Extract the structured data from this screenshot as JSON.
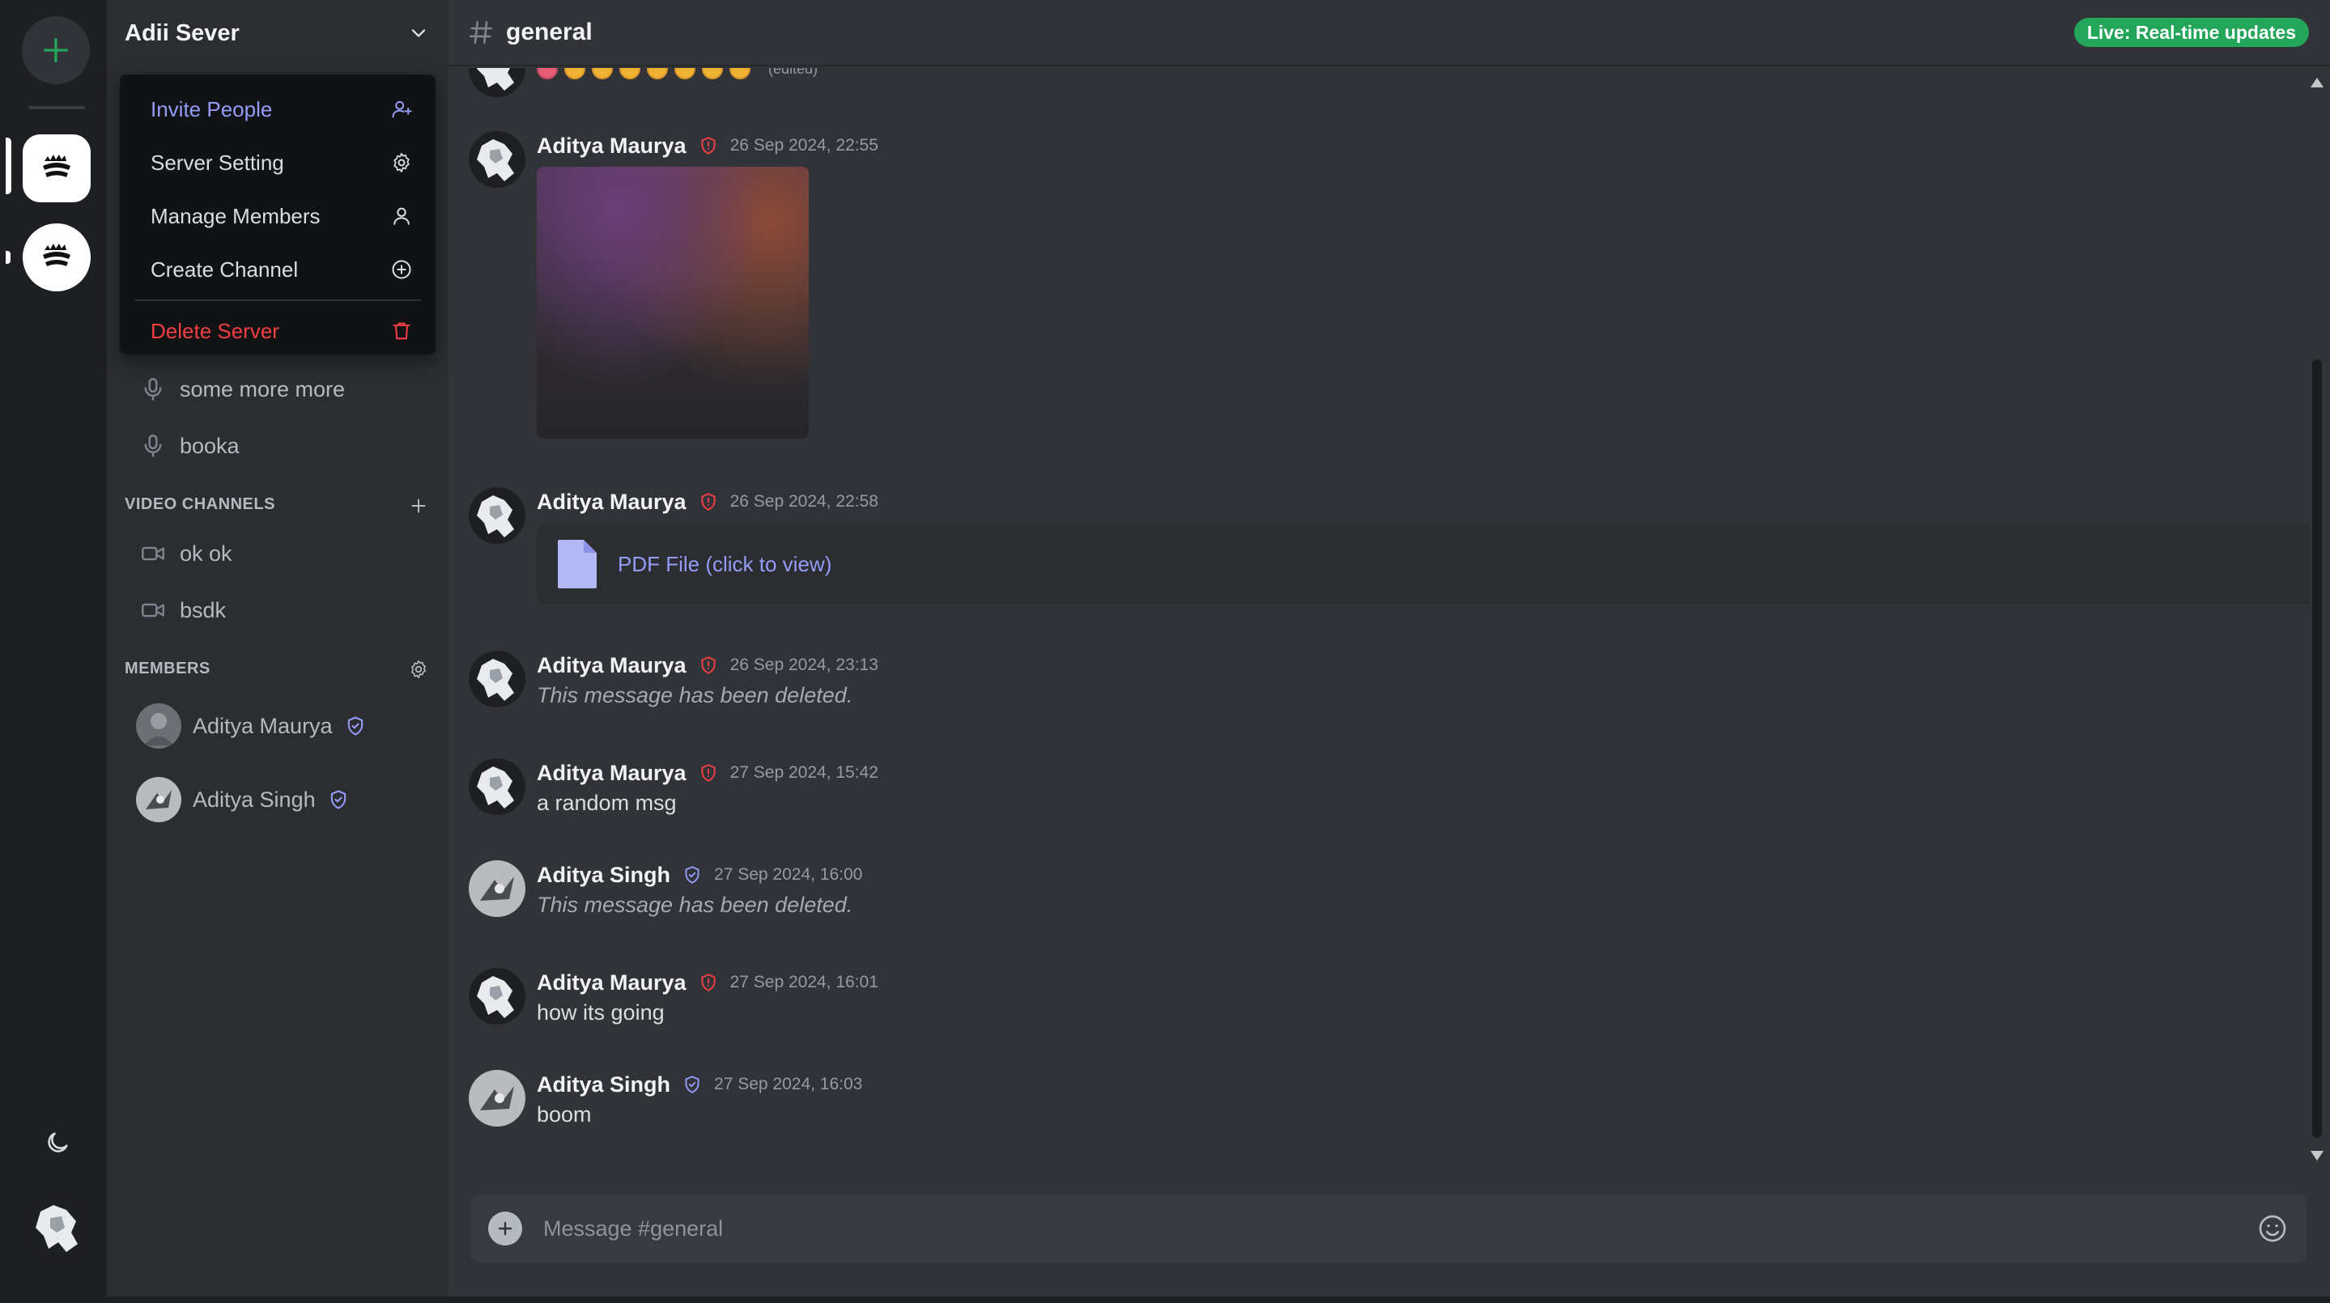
{
  "server": {
    "name": "Adii Sever"
  },
  "menu": {
    "items": [
      {
        "label": "Invite People",
        "icon": "user-plus-icon"
      },
      {
        "label": "Server Setting",
        "icon": "gear-icon"
      },
      {
        "label": "Manage Members",
        "icon": "user-icon"
      },
      {
        "label": "Create Channel",
        "icon": "plus-circle-icon"
      },
      {
        "label": "Delete Server",
        "icon": "trash-icon"
      }
    ]
  },
  "sidebar": {
    "audio_channels": [
      "some more more",
      "booka"
    ],
    "video_section_label": "VIDEO CHANNELS",
    "video_channels": [
      "ok ok",
      "bsdk"
    ],
    "members_section_label": "MEMBERS",
    "members": [
      {
        "name": "Aditya Maurya",
        "role_icon": "shield-check-icon"
      },
      {
        "name": "Aditya Singh",
        "role_icon": "shield-check-icon"
      }
    ]
  },
  "header": {
    "channel": "general",
    "live_badge": "Live: Real-time updates"
  },
  "messages": [
    {
      "author": "Aditya Maurya",
      "role": "admin",
      "time": "26 Sep 2024, 22:55",
      "type": "image"
    },
    {
      "author": "Aditya Maurya",
      "role": "admin",
      "time": "26 Sep 2024, 22:58",
      "type": "file",
      "file_label": "PDF File (click to view)"
    },
    {
      "author": "Aditya Maurya",
      "role": "admin",
      "time": "26 Sep 2024, 23:13",
      "type": "deleted",
      "text": "This message has been deleted."
    },
    {
      "author": "Aditya Maurya",
      "role": "admin",
      "time": "27 Sep 2024, 15:42",
      "type": "text",
      "text": "a random msg"
    },
    {
      "author": "Aditya Singh",
      "role": "moderator",
      "time": "27 Sep 2024, 16:00",
      "type": "deleted",
      "text": "This message has been deleted."
    },
    {
      "author": "Aditya Maurya",
      "role": "admin",
      "time": "27 Sep 2024, 16:01",
      "type": "text",
      "text": "how its going"
    },
    {
      "author": "Aditya Singh",
      "role": "moderator",
      "time": "27 Sep 2024, 16:03",
      "type": "text",
      "text": "boom"
    }
  ],
  "partial_message": {
    "edited_label": "(edited)",
    "emoji_count": 8
  },
  "composer": {
    "placeholder": "Message #general"
  },
  "colors": {
    "accent": "#949cf7",
    "danger": "#f23f43",
    "live": "#23a55a",
    "admin_shield": "#f23f43",
    "moderator_shield": "#949cf7"
  }
}
